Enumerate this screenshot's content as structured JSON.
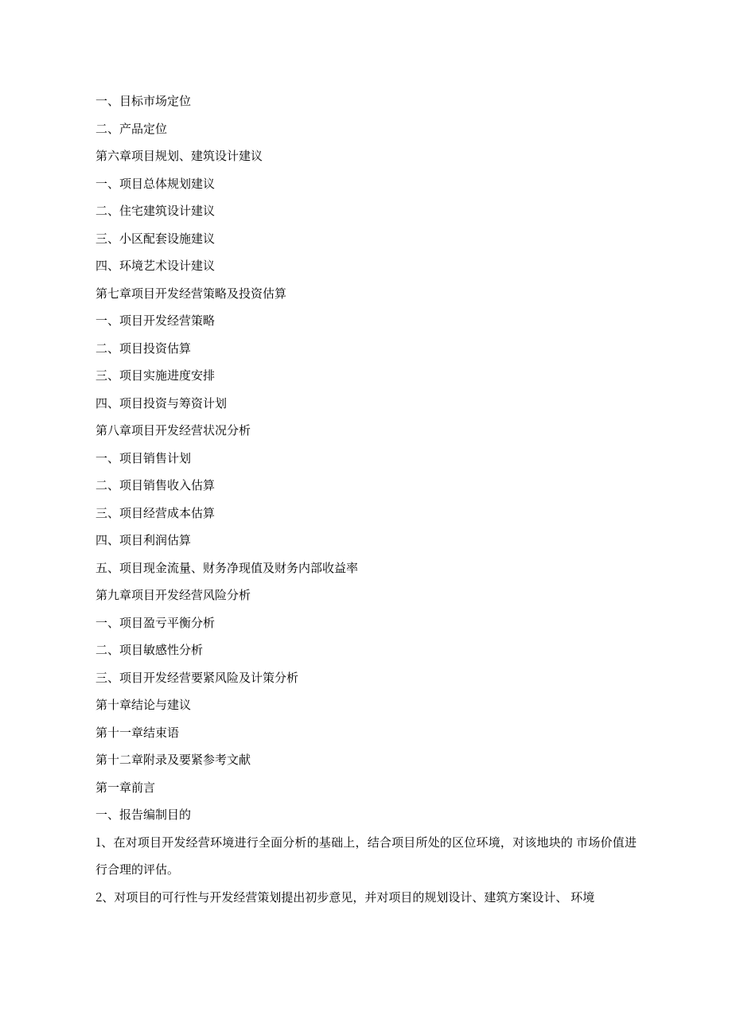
{
  "lines": [
    "一、目标市场定位",
    "二、产品定位",
    "第六章项目规划、建筑设计建议",
    "一、项目总体规划建议",
    "二、住宅建筑设计建议",
    "三、小区配套设施建议",
    "四、环境艺术设计建议",
    "第七章项目开发经营策略及投资估算",
    "一、项目开发经营策略",
    "二、项目投资估算",
    "三、项目实施进度安排",
    "四、项目投资与筹资计划",
    "第八章项目开发经营状况分析",
    "一、项目销售计划",
    "二、项目销售收入估算",
    "三、项目经营成本估算",
    "四、项目利润估算",
    "五、项目现金流量、财务净现值及财务内部收益率",
    "第九章项目开发经营风险分析",
    "一、项目盈亏平衡分析",
    "二、项目敏感性分析",
    "三、项目开发经营要紧风险及计策分析",
    "第十章结论与建议",
    "第十一章结束语",
    "第十二章附录及要紧参考文献",
    "第一章前言",
    "一、报告编制目的",
    "1、在对项目开发经营环境进行全面分析的基础上，结合项目所处的区位环境，对该地块的 市场价值进行合理的评估。",
    "2、对项目的可行性与开发经营策划提出初步意见，并对项目的规划设计、建筑方案设计、 环境"
  ]
}
